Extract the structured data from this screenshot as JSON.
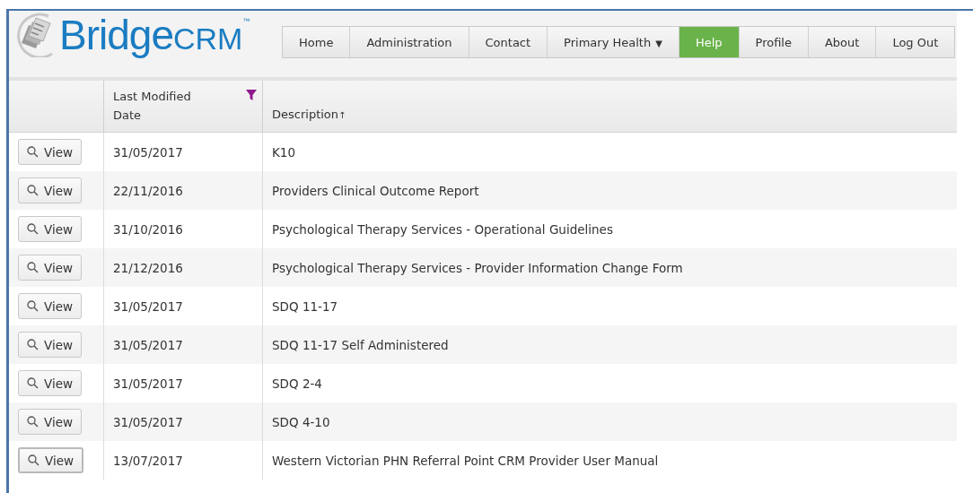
{
  "logo": {
    "name": "Bridge",
    "suffix": "CRM",
    "mark": "™"
  },
  "nav": [
    {
      "label": "Home",
      "selected": false
    },
    {
      "label": "Administration",
      "selected": false
    },
    {
      "label": "Contact",
      "selected": false
    },
    {
      "label": "Primary Health",
      "selected": false,
      "caret": "▼"
    },
    {
      "label": "Help",
      "selected": true
    },
    {
      "label": "Profile",
      "selected": false
    },
    {
      "label": "About",
      "selected": false
    },
    {
      "label": "Log Out",
      "selected": false
    }
  ],
  "table": {
    "columns": [
      {
        "label": "Last Modified Date",
        "filtered": true
      },
      {
        "label": "Description",
        "sort": "↑"
      }
    ],
    "rows": [
      {
        "action": "View",
        "focused": false,
        "date": "31/05/2017",
        "description": "K10"
      },
      {
        "action": "View",
        "focused": false,
        "date": "22/11/2016",
        "description": "Providers Clinical Outcome Report"
      },
      {
        "action": "View",
        "focused": false,
        "date": "31/10/2016",
        "description": "Psychological Therapy Services - Operational Guidelines"
      },
      {
        "action": "View",
        "focused": false,
        "date": "21/12/2016",
        "description": "Psychological Therapy Services - Provider Information Change Form"
      },
      {
        "action": "View",
        "focused": false,
        "date": "31/05/2017",
        "description": "SDQ 11-17"
      },
      {
        "action": "View",
        "focused": false,
        "date": "31/05/2017",
        "description": "SDQ 11-17 Self Administered"
      },
      {
        "action": "View",
        "focused": false,
        "date": "31/05/2017",
        "description": "SDQ 2-4"
      },
      {
        "action": "View",
        "focused": false,
        "date": "31/05/2017",
        "description": "SDQ 4-10"
      },
      {
        "action": "View",
        "focused": true,
        "date": "13/07/2017",
        "description": "Western Victorian PHN Referral Point CRM Provider User Manual"
      }
    ]
  }
}
